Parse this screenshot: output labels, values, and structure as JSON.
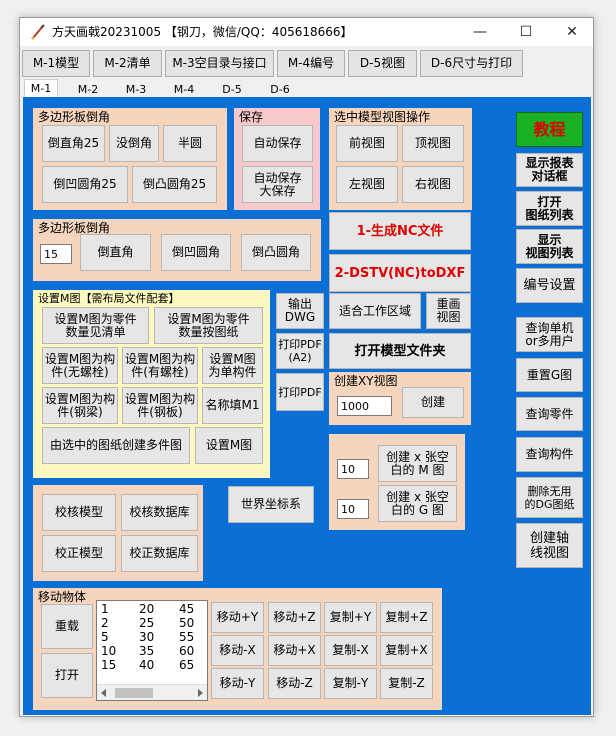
{
  "window": {
    "title": "方天画戟20231005 【钢刀，微信/QQ：405618666】",
    "minimize": "—",
    "maximize": "☐",
    "close": "✕"
  },
  "toolbar": {
    "items": [
      "M-1模型",
      "M-2清单",
      "M-3空目录与接口",
      "M-4编号",
      "D-5视图",
      "D-6尺寸与打印"
    ]
  },
  "tabs": [
    "M-1",
    "M-2",
    "M-3",
    "M-4",
    "D-5",
    "D-6"
  ],
  "panel_chamfer": {
    "title": "多边形板倒角",
    "buttons": [
      "倒直角25",
      "没倒角",
      "半圆",
      "倒凹圆角25",
      "倒凸圆角25"
    ]
  },
  "panel_save": {
    "title": "保存",
    "auto_save": "自动保存",
    "auto_save_big": "自动保存\n大保存"
  },
  "panel_view": {
    "title": "选中模型视图操作",
    "buttons": [
      "前视图",
      "顶视图",
      "左视图",
      "右视图"
    ]
  },
  "right_column": {
    "tutorial": "教程",
    "show_report": "显示报表\n对话框",
    "open_drawing_list": "打开\n图纸列表",
    "show_view_list": "显示\n视图列表",
    "numbering_settings": "编号设置",
    "query_single": "查询单机\nor多用户",
    "reset_g": "重置G图",
    "query_part": "查询零件",
    "query_member": "查询构件",
    "delete_unused_dg": "删除无用\n的DG图纸",
    "create_axis_view": "创建轴\n线视图"
  },
  "panel_chamfer2": {
    "title": "多边形板倒角",
    "input_value": "15",
    "buttons": [
      "倒直角",
      "倒凹圆角",
      "倒凸圆角"
    ]
  },
  "nc": {
    "generate_nc": "1-生成NC文件",
    "dstv": "2-DSTV(NC)toDXF"
  },
  "panel_setm": {
    "title": "设置M图【需布局文件配套】",
    "buttons": [
      "设置M图为零件\n数量见清单",
      "设置M图为零件\n数量按图纸",
      "设置M图为构\n件(无螺栓)",
      "设置M图为构\n件(有螺栓)",
      "设置M图\n为单构件",
      "设置M图为构\n件(钢梁)",
      "设置M图为构\n件(钢板)",
      "名称填M1",
      "由选中的图纸创建多件图",
      "设置M图"
    ]
  },
  "misc": {
    "output_dwg": "输出DWG",
    "print_pdf_a2": "打印PDF\n(A2)",
    "print_pdf": "打印PDF",
    "fit_work_area": "适合工作区域",
    "redraw_view": "重画\n视图",
    "open_model_folder": "打开模型文件夹"
  },
  "panel_xy": {
    "title": "创建XY视图",
    "input_value": "1000",
    "create": "创建"
  },
  "panel_blank": {
    "m_value": "10",
    "g_value": "10",
    "create_m": "创建 x 张空\n白的 M 图",
    "create_g": "创建 x 张空\n白的 G 图"
  },
  "panel_check": {
    "buttons": [
      "校核模型",
      "校核数据库",
      "校正模型",
      "校正数据库"
    ]
  },
  "world_coords": "世界坐标系",
  "panel_move": {
    "title": "移动物体",
    "reload": "重载",
    "open": "打开",
    "list_rows": [
      [
        "1",
        "20",
        "45"
      ],
      [
        "2",
        "25",
        "50"
      ],
      [
        "5",
        "30",
        "55"
      ],
      [
        "10",
        "35",
        "60"
      ],
      [
        "15",
        "40",
        "65"
      ]
    ],
    "buttons": [
      "移动+Y",
      "移动+Z",
      "复制+Y",
      "复制+Z",
      "移动-X",
      "移动+X",
      "复制-X",
      "复制+X",
      "移动-Y",
      "移动-Z",
      "复制-Y",
      "复制-Z"
    ]
  },
  "colors": {
    "client_bg": "#0a6fd4",
    "peach": "#f5d5bd",
    "pink": "#f7c9cc",
    "yellow": "#fdf8be",
    "tutorial_green": "#19b024",
    "tutorial_text": "#e00000"
  }
}
